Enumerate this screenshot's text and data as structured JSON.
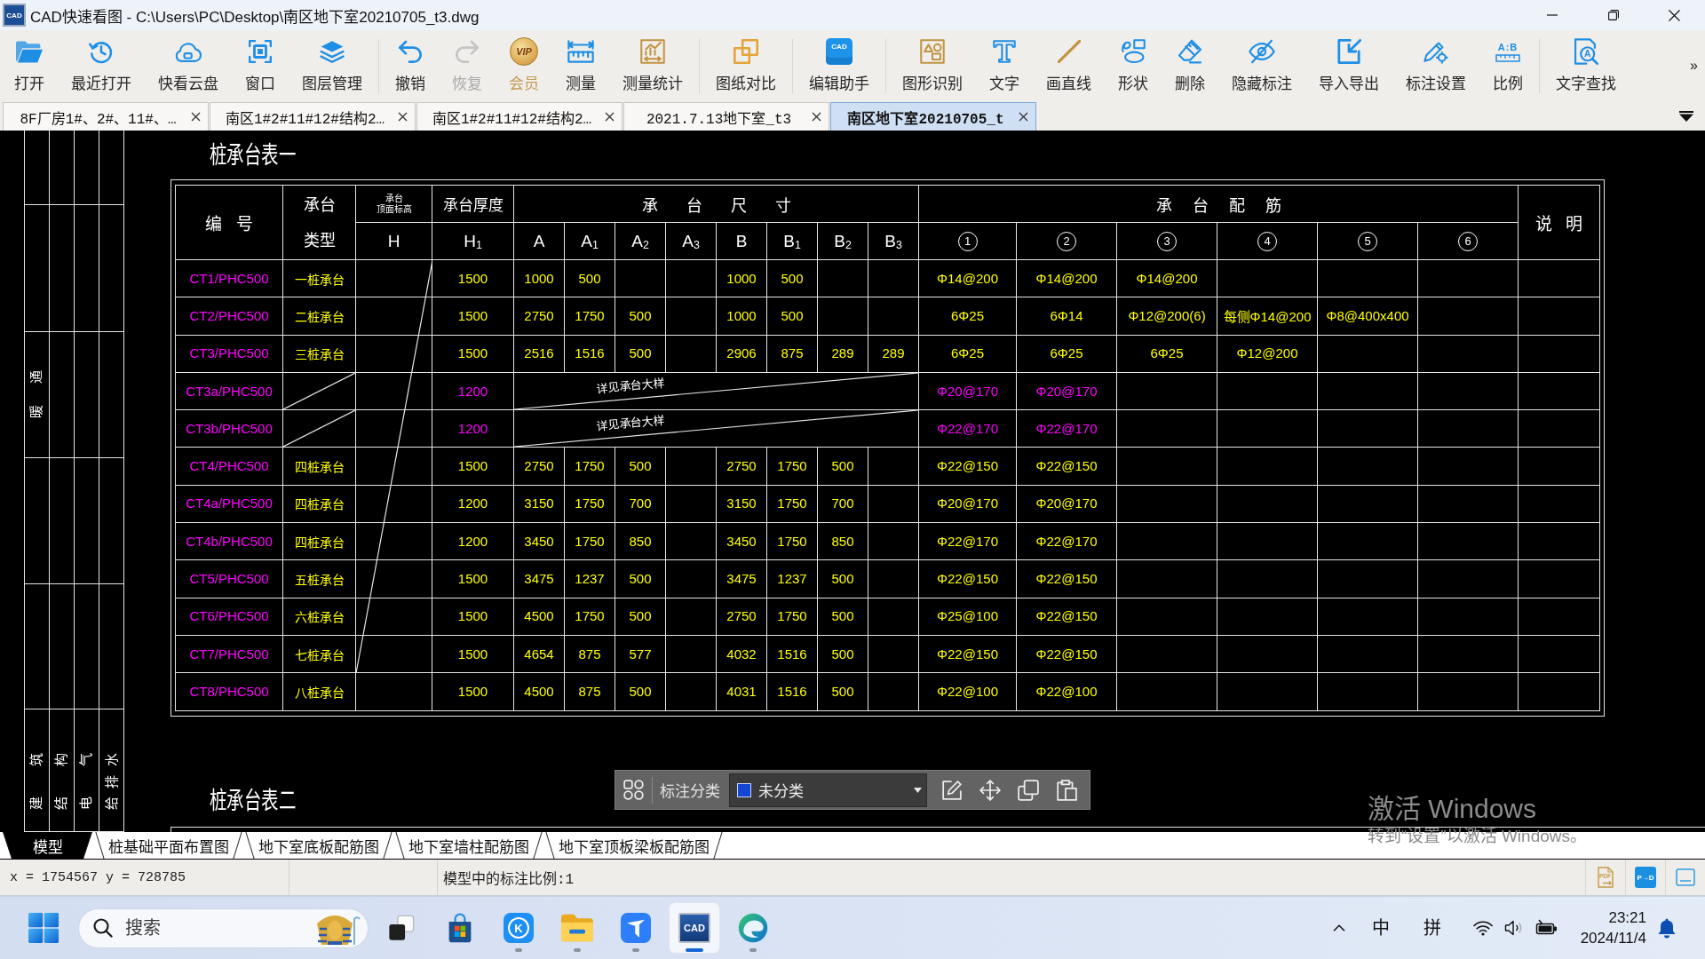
{
  "window": {
    "icon_text": "CAD",
    "title": "CAD快速看图 - C:\\Users\\PC\\Desktop\\南区地下室20210705_t3.dwg"
  },
  "toolbar": {
    "groups": [
      [
        {
          "label": "打开",
          "kind": "standard",
          "disabled": false
        },
        {
          "label": "最近打开",
          "kind": "standard",
          "disabled": false
        },
        {
          "label": "快看云盘",
          "kind": "standard",
          "disabled": false
        },
        {
          "label": "窗口",
          "kind": "standard",
          "disabled": false
        },
        {
          "label": "图层管理",
          "kind": "standard",
          "disabled": false
        }
      ],
      [
        {
          "label": "撤销",
          "kind": "standard",
          "disabled": false
        },
        {
          "label": "恢复",
          "kind": "standard",
          "disabled": true
        },
        {
          "label": "会员",
          "kind": "premium",
          "disabled": false,
          "icon_text": "VIP"
        },
        {
          "label": "测量",
          "kind": "standard",
          "disabled": false
        },
        {
          "label": "测量统计",
          "kind": "standard",
          "disabled": false
        }
      ],
      [
        {
          "label": "图纸对比",
          "kind": "standard",
          "disabled": false
        }
      ],
      [
        {
          "label": "编辑助手",
          "kind": "standard",
          "disabled": false,
          "icon_text": "CAD"
        }
      ],
      [
        {
          "label": "图形识别",
          "kind": "standard",
          "disabled": false
        },
        {
          "label": "文字",
          "kind": "standard",
          "disabled": false
        },
        {
          "label": "画直线",
          "kind": "standard",
          "disabled": false
        },
        {
          "label": "形状",
          "kind": "standard",
          "disabled": false
        },
        {
          "label": "删除",
          "kind": "standard",
          "disabled": false
        },
        {
          "label": "隐藏标注",
          "kind": "standard",
          "disabled": false
        },
        {
          "label": "导入导出",
          "kind": "standard",
          "disabled": false
        },
        {
          "label": "标注设置",
          "kind": "standard",
          "disabled": false
        },
        {
          "label": "比例",
          "kind": "standard",
          "disabled": false,
          "icon_text": "A:B"
        }
      ],
      [
        {
          "label": "文字查找",
          "kind": "standard",
          "disabled": false,
          "icon_text": "A"
        }
      ]
    ],
    "overflow": "»"
  },
  "document_tabs": [
    {
      "label": "8F厂房1#、2#、11#、…",
      "selected": false
    },
    {
      "label": "南区1#2#11#12#结构2…",
      "selected": false
    },
    {
      "label": "南区1#2#11#12#结构2…",
      "selected": false
    },
    {
      "label": "2021.7.13地下室_t3",
      "selected": false
    },
    {
      "label": "南区地下室20210705_t",
      "selected": true
    }
  ],
  "drawing": {
    "title_block": {
      "middle_label": "暖通",
      "disciplines": [
        "建筑",
        "结构",
        "电气",
        "给排水"
      ]
    },
    "table": {
      "title": "桩承台表一",
      "columns": {
        "number": "编 号",
        "type": "承台类型",
        "elevation": {
          "label": [
            "承台",
            "顶面标高"
          ],
          "symbol": "H"
        },
        "thickness": {
          "label": "承台厚度",
          "symbol": "H$_{1}$"
        },
        "dimensions": {
          "label": "承 台 尺 寸",
          "symbols": [
            "A",
            "A$_{1}$",
            "A$_{2}$",
            "A$_{3}$",
            "B",
            "B$_{1}$",
            "B$_{2}$",
            "B$_{3}$"
          ]
        },
        "reinforcement": {
          "label": "承 台 配 筋",
          "marks": [
            "1",
            "2",
            "3",
            "4",
            "5",
            "6"
          ]
        },
        "remarks": "说 明"
      },
      "rows": [
        {
          "kind": "standard",
          "color": "#ffff00",
          "id": "CT1/PHC500",
          "type": "一桩承台",
          "thickness": "1500",
          "dimensions": {
            "A": "1000",
            "A1": "500",
            "B": "1000",
            "B1": "500"
          },
          "rebar": [
            "Φ14@200",
            "Φ14@200",
            "Φ14@200"
          ]
        },
        {
          "kind": "standard",
          "color": "#ffff00",
          "id": "CT2/PHC500",
          "type": "二桩承台",
          "thickness": "1500",
          "dimensions": {
            "A": "2750",
            "A1": "1750",
            "A2": "500",
            "B": "1000",
            "B1": "500"
          },
          "rebar": [
            "6Φ25",
            "6Φ14",
            "Φ12@200(6)",
            "每侧Φ14@200",
            "Φ8@400x400"
          ]
        },
        {
          "kind": "standard",
          "color": "#ffff00",
          "id": "CT3/PHC500",
          "type": "三桩承台",
          "thickness": "1500",
          "dimensions": {
            "A": "2516",
            "A1": "1516",
            "A2": "500",
            "B": "2906",
            "B1": "875",
            "B2": "289",
            "B3": "289"
          },
          "rebar": [
            "6Φ25",
            "6Φ25",
            "6Φ25",
            "Φ12@200"
          ]
        },
        {
          "kind": "detail",
          "color": "#ff00ff",
          "id": "CT3a/PHC500",
          "thickness": "1200",
          "note": "详见承台大样",
          "rebar": [
            "Φ20@170",
            "Φ20@170"
          ]
        },
        {
          "kind": "detail",
          "color": "#ff00ff",
          "id": "CT3b/PHC500",
          "thickness": "1200",
          "note": "详见承台大样",
          "rebar": [
            "Φ22@170",
            "Φ22@170"
          ]
        },
        {
          "kind": "standard",
          "color": "#ffff00",
          "id": "CT4/PHC500",
          "type": "四桩承台",
          "thickness": "1500",
          "dimensions": {
            "A": "2750",
            "A1": "1750",
            "A2": "500",
            "B": "2750",
            "B1": "1750",
            "B2": "500"
          },
          "rebar": [
            "Φ22@150",
            "Φ22@150"
          ]
        },
        {
          "kind": "standard",
          "color": "#ffff00",
          "id": "CT4a/PHC500",
          "type": "四桩承台",
          "thickness": "1200",
          "dimensions": {
            "A": "3150",
            "A1": "1750",
            "A2": "700",
            "B": "3150",
            "B1": "1750",
            "B2": "700"
          },
          "rebar": [
            "Φ20@170",
            "Φ20@170"
          ]
        },
        {
          "kind": "standard",
          "color": "#ffff00",
          "id": "CT4b/PHC500",
          "type": "四桩承台",
          "thickness": "1200",
          "dimensions": {
            "A": "3450",
            "A1": "1750",
            "A2": "850",
            "B": "3450",
            "B1": "1750",
            "B2": "850"
          },
          "rebar": [
            "Φ22@170",
            "Φ22@170"
          ]
        },
        {
          "kind": "standard",
          "color": "#ffff00",
          "id": "CT5/PHC500",
          "type": "五桩承台",
          "thickness": "1500",
          "dimensions": {
            "A": "3475",
            "A1": "1237",
            "A2": "500",
            "B": "3475",
            "B1": "1237",
            "B2": "500"
          },
          "rebar": [
            "Φ22@150",
            "Φ22@150"
          ]
        },
        {
          "kind": "standard",
          "color": "#ffff00",
          "id": "CT6/PHC500",
          "type": "六桩承台",
          "thickness": "1500",
          "dimensions": {
            "A": "4500",
            "A1": "1750",
            "A2": "500",
            "B": "2750",
            "B1": "1750",
            "B2": "500"
          },
          "rebar": [
            "Φ25@100",
            "Φ22@150"
          ]
        },
        {
          "kind": "standard",
          "color": "#ffff00",
          "id": "CT7/PHC500",
          "type": "七桩承台",
          "thickness": "1500",
          "dimensions": {
            "A": "4654",
            "A1": "875",
            "A2": "577",
            "B": "4032",
            "B1": "1516",
            "B2": "500"
          },
          "rebar": [
            "Φ22@150",
            "Φ22@150"
          ]
        },
        {
          "kind": "standard",
          "color": "#ffff00",
          "id": "CT8/PHC500",
          "type": "八桩承台",
          "thickness": "1500",
          "dimensions": {
            "A": "4500",
            "A1": "875",
            "A2": "500",
            "B": "4031",
            "B1": "1516",
            "B2": "500"
          },
          "rebar": [
            "Φ22@100",
            "Φ22@100"
          ]
        }
      ]
    },
    "next_table": {
      "title": "桩承台表二"
    },
    "annotation_bar": {
      "label": "标注分类",
      "category": {
        "label": "未分类",
        "color": "#1446d4"
      }
    }
  },
  "layout_tabs": [
    {
      "label": "模型",
      "selected": true
    },
    {
      "label": "桩基础平面布置图",
      "selected": false
    },
    {
      "label": "地下室底板配筋图",
      "selected": false
    },
    {
      "label": "地下室墙柱配筋图",
      "selected": false
    },
    {
      "label": "地下室顶板梁板配筋图",
      "selected": false
    }
  ],
  "status_bar": {
    "coordinates": "x = 1754567 y = 728785",
    "scale": "模型中的标注比例:1",
    "pdf_icon_text": "PDF",
    "convert_button": "P→D"
  },
  "activation_notice": {
    "title": "激活 Windows",
    "subtitle": "转到“设置”以激活 Windows。"
  },
  "taskbar": {
    "search": {
      "placeholder": "搜索"
    },
    "apps": [
      {
        "running": false,
        "selected": false
      },
      {
        "running": false,
        "selected": false
      },
      {
        "icon_text": "K",
        "running": true,
        "selected": false
      },
      {
        "running": true,
        "selected": false
      },
      {
        "running": true,
        "selected": false
      },
      {
        "icon_text": "CAD",
        "running": true,
        "selected": true
      },
      {
        "running": true,
        "selected": false
      }
    ],
    "tray": {
      "input_mode": "中",
      "input_method": "拼",
      "time": "23:21",
      "date": "2024/11/4"
    }
  }
}
